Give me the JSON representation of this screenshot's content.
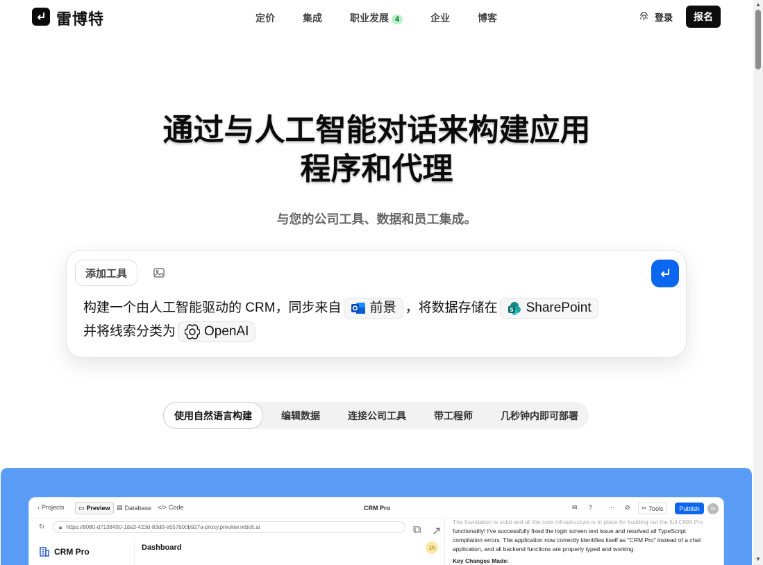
{
  "nav": {
    "brand": "雷博特",
    "links": [
      {
        "label": "定价"
      },
      {
        "label": "集成"
      },
      {
        "label": "职业发展",
        "badge": "4"
      },
      {
        "label": "企业"
      },
      {
        "label": "博客"
      }
    ],
    "login": "登录",
    "signup": "报名"
  },
  "hero": {
    "title_line1": "通过与人工智能对话来构建应用",
    "title_line2": "程序和代理",
    "subtitle": "与您的公司工具、数据和员工集成。"
  },
  "prompt": {
    "add_tool": "添加工具",
    "text_1": "构建一个由人工智能驱动的 CRM，同步来自",
    "chip_outlook": "前景",
    "text_2": "，将数据存储在",
    "chip_sharepoint": "SharePoint",
    "text_3": "并将线索分类为",
    "chip_openai": "OpenAI"
  },
  "tabs": [
    {
      "label": "使用自然语言构建",
      "active": true
    },
    {
      "label": "编辑数据"
    },
    {
      "label": "连接公司工具"
    },
    {
      "label": "带工程师"
    },
    {
      "label": "几秒钟内即可部署"
    }
  ],
  "demo": {
    "projects": "Projects",
    "preview": "Preview",
    "database": "Database",
    "code": "Code",
    "title": "CRM Pro",
    "tools": "Tools",
    "publish": "Publish",
    "avatar": "IS",
    "url": "https://8080-d7138490-1da3-423d-83d0-e557b00b927a-proxy.preview.rebolt.ai",
    "app_name": "CRM Pro",
    "dashboard": "Dashboard",
    "user_initials": "JA",
    "chat_faded": "The foundation is solid and all the core infrastructure is in place for building out the full CRM Pro",
    "chat_body": "functionality! I've successfully fixed the login screen text issue and resolved all TypeScript compilation errors. The application now correctly identifies itself as \"CRM Pro\" instead of a chat application, and all backend functions are properly typed and working.",
    "chat_heading": "Key Changes Made:"
  },
  "colors": {
    "accent": "#0b66f0",
    "demo_bg": "#5b9cf7",
    "badge_bg": "#b8f0c8"
  }
}
